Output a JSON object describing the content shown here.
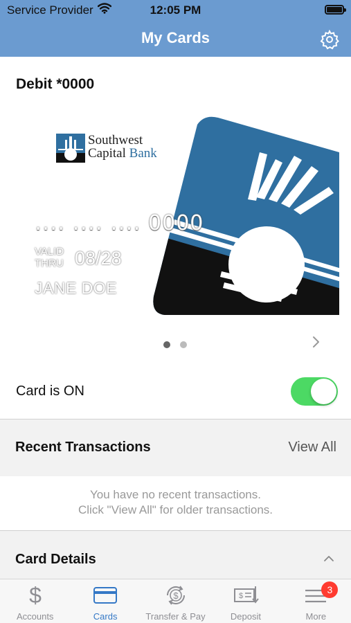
{
  "status_bar": {
    "carrier": "Service Provider",
    "time": "12:05 PM",
    "icons": [
      "wifi-icon",
      "battery-icon"
    ]
  },
  "nav": {
    "title": "My Cards",
    "settings_icon": "gear-icon"
  },
  "card": {
    "name": "Debit *0000",
    "bank_name_line1": "Southwest",
    "bank_name_line2_a": "Capital",
    "bank_name_line2_b": "Bank",
    "number_masked": "․․․․ ․․․․ ․․․․ 0000",
    "valid_thru_label_1": "VALID",
    "valid_thru_label_2": "THRU",
    "expiry": "08/28",
    "holder": "JANE DOE",
    "page_dots": {
      "count": 2,
      "active": 0
    },
    "colors": {
      "accent": "#2f6fa0",
      "black": "#111111"
    }
  },
  "card_status": {
    "label": "Card is ON",
    "toggle_on": true,
    "toggle_color": "#4cd964"
  },
  "recent_transactions": {
    "title": "Recent Transactions",
    "view_all": "View All",
    "empty_line1": "You have no recent transactions.",
    "empty_line2": "Click \"View All\" for older transactions."
  },
  "card_details": {
    "title": "Card Details"
  },
  "tabs": [
    {
      "label": "Accounts",
      "icon": "dollar-icon",
      "active": false
    },
    {
      "label": "Cards",
      "icon": "card-icon",
      "active": true
    },
    {
      "label": "Transfer & Pay",
      "icon": "transfer-icon",
      "active": false
    },
    {
      "label": "Deposit",
      "icon": "check-deposit-icon",
      "active": false
    },
    {
      "label": "More",
      "icon": "menu-icon",
      "active": false,
      "badge": "3"
    }
  ],
  "colors": {
    "header": "#6b9bd0",
    "tab_active": "#3478c6",
    "tab_inactive": "#8e8e93",
    "badge": "#ff3b30"
  }
}
